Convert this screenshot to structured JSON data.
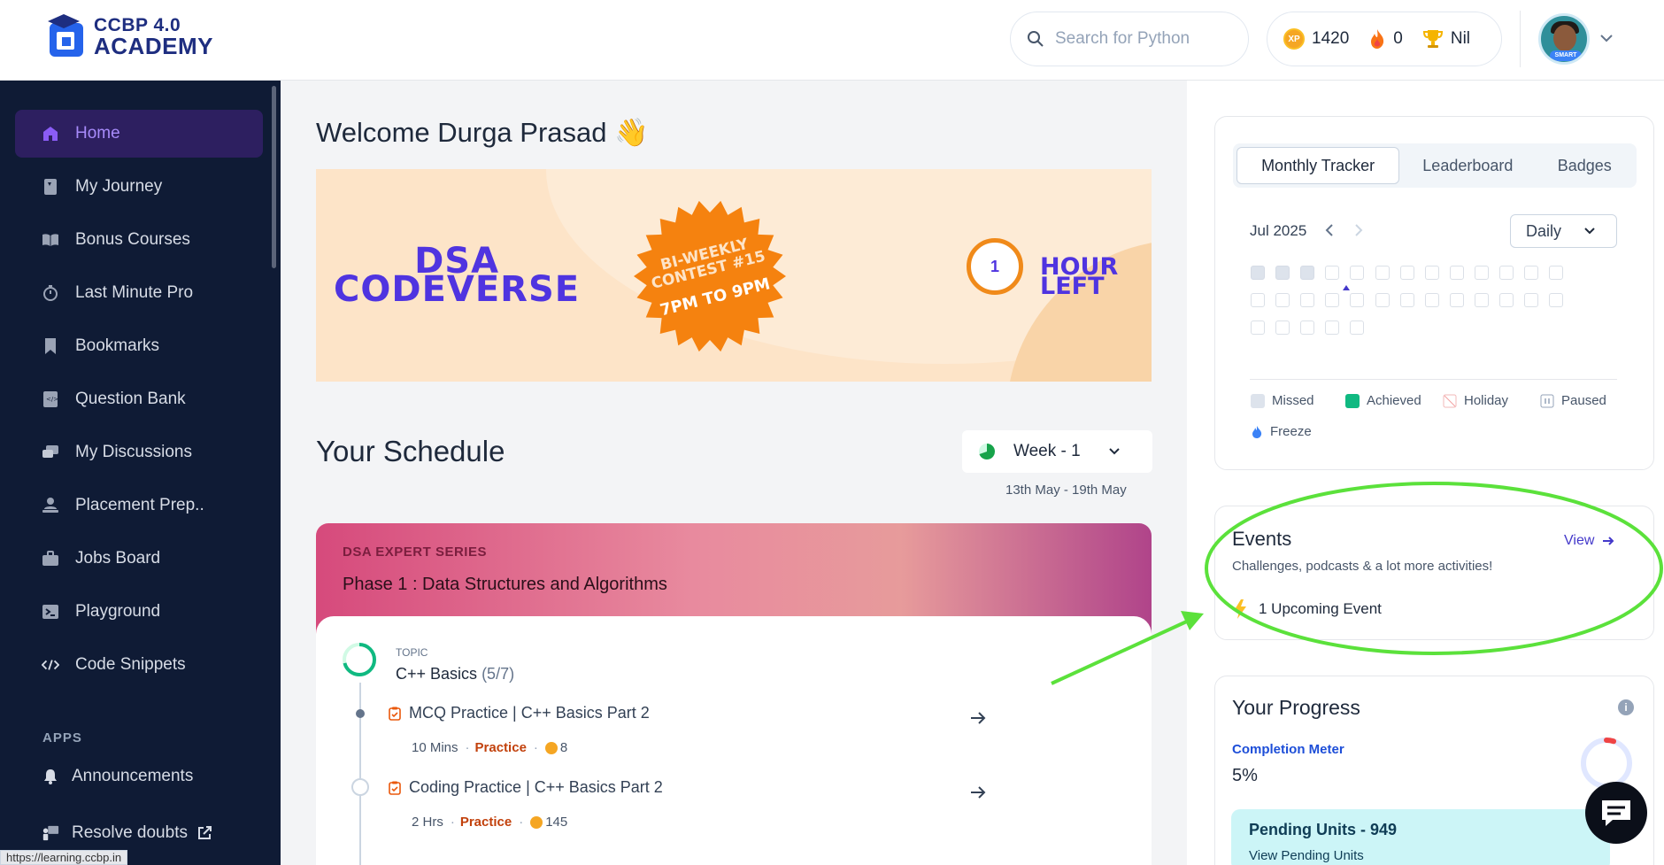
{
  "header": {
    "logo_line1": "CCBP 4.0",
    "logo_line2": "ACADEMY",
    "search_placeholder": "Search for Python",
    "xp_badge": "XP",
    "xp": "1420",
    "streak": "0",
    "rank": "Nil",
    "avatar_badge": "SMART"
  },
  "sidebar": {
    "items": [
      {
        "label": "Home",
        "icon": "home-icon"
      },
      {
        "label": "My Journey",
        "icon": "journey-icon"
      },
      {
        "label": "Bonus Courses",
        "icon": "book-icon"
      },
      {
        "label": "Last Minute Pro",
        "icon": "stopwatch-icon"
      },
      {
        "label": "Bookmarks",
        "icon": "bookmark-icon"
      },
      {
        "label": "Question Bank",
        "icon": "code-file-icon"
      },
      {
        "label": "My Discussions",
        "icon": "discussion-icon"
      },
      {
        "label": "Placement Prep..",
        "icon": "person-desk-icon"
      },
      {
        "label": "Jobs Board",
        "icon": "briefcase-icon"
      },
      {
        "label": "Playground",
        "icon": "terminal-icon"
      },
      {
        "label": "Code Snippets",
        "icon": "code-icon"
      }
    ],
    "apps_label": "APPS",
    "apps": [
      {
        "label": "Announcements",
        "icon": "bell-icon"
      },
      {
        "label": "Resolve doubts",
        "icon": "person-board-icon"
      }
    ],
    "status_url": "https://learning.ccbp.in"
  },
  "main": {
    "welcome": "Welcome Durga Prasad 👋",
    "banner": {
      "title_line1": "DSA",
      "title_line2": "CODEVERSE",
      "contest_line1": "BI-WEEKLY",
      "contest_line2": "CONTEST #15",
      "contest_time": "7PM TO 9PM",
      "timer_value": "1",
      "hour_line1": "HOUR",
      "hour_line2": "LEFT"
    },
    "schedule_title": "Your Schedule",
    "week_label": "Week - 1",
    "week_dates": "13th May - 19th May",
    "series": {
      "tag": "DSA EXPERT SERIES",
      "title": "Phase 1 : Data Structures and Algorithms",
      "topic_label": "TOPIC",
      "topic_name": "C++ Basics",
      "topic_count": "(5/7)",
      "tasks": [
        {
          "name": "MCQ Practice | C++ Basics Part 2",
          "duration": "10 Mins",
          "type": "Practice",
          "coins": "8"
        },
        {
          "name": "Coding Practice | C++ Basics Part 2",
          "duration": "2 Hrs",
          "type": "Practice",
          "coins": "145"
        }
      ]
    }
  },
  "right": {
    "tabs": [
      "Monthly Tracker",
      "Leaderboard",
      "Badges"
    ],
    "month": "Jul 2025",
    "period": "Daily",
    "legend": {
      "missed": "Missed",
      "achieved": "Achieved",
      "holiday": "Holiday",
      "paused": "Paused",
      "freeze": "Freeze"
    },
    "colors": {
      "achieved": "#10b981",
      "missed": "#dde3ec",
      "accent": "#4338ca",
      "annotation": "#5be13b"
    },
    "events": {
      "title": "Events",
      "view": "View",
      "subtitle": "Challenges, podcasts & a lot more activities!",
      "upcoming": "1 Upcoming Event"
    },
    "progress": {
      "title": "Your Progress",
      "completion_label": "Completion Meter",
      "completion_value": "5%",
      "completion_fraction": 0.05,
      "pending": "Pending Units - 949",
      "pending_link": "View Pending Units"
    }
  }
}
